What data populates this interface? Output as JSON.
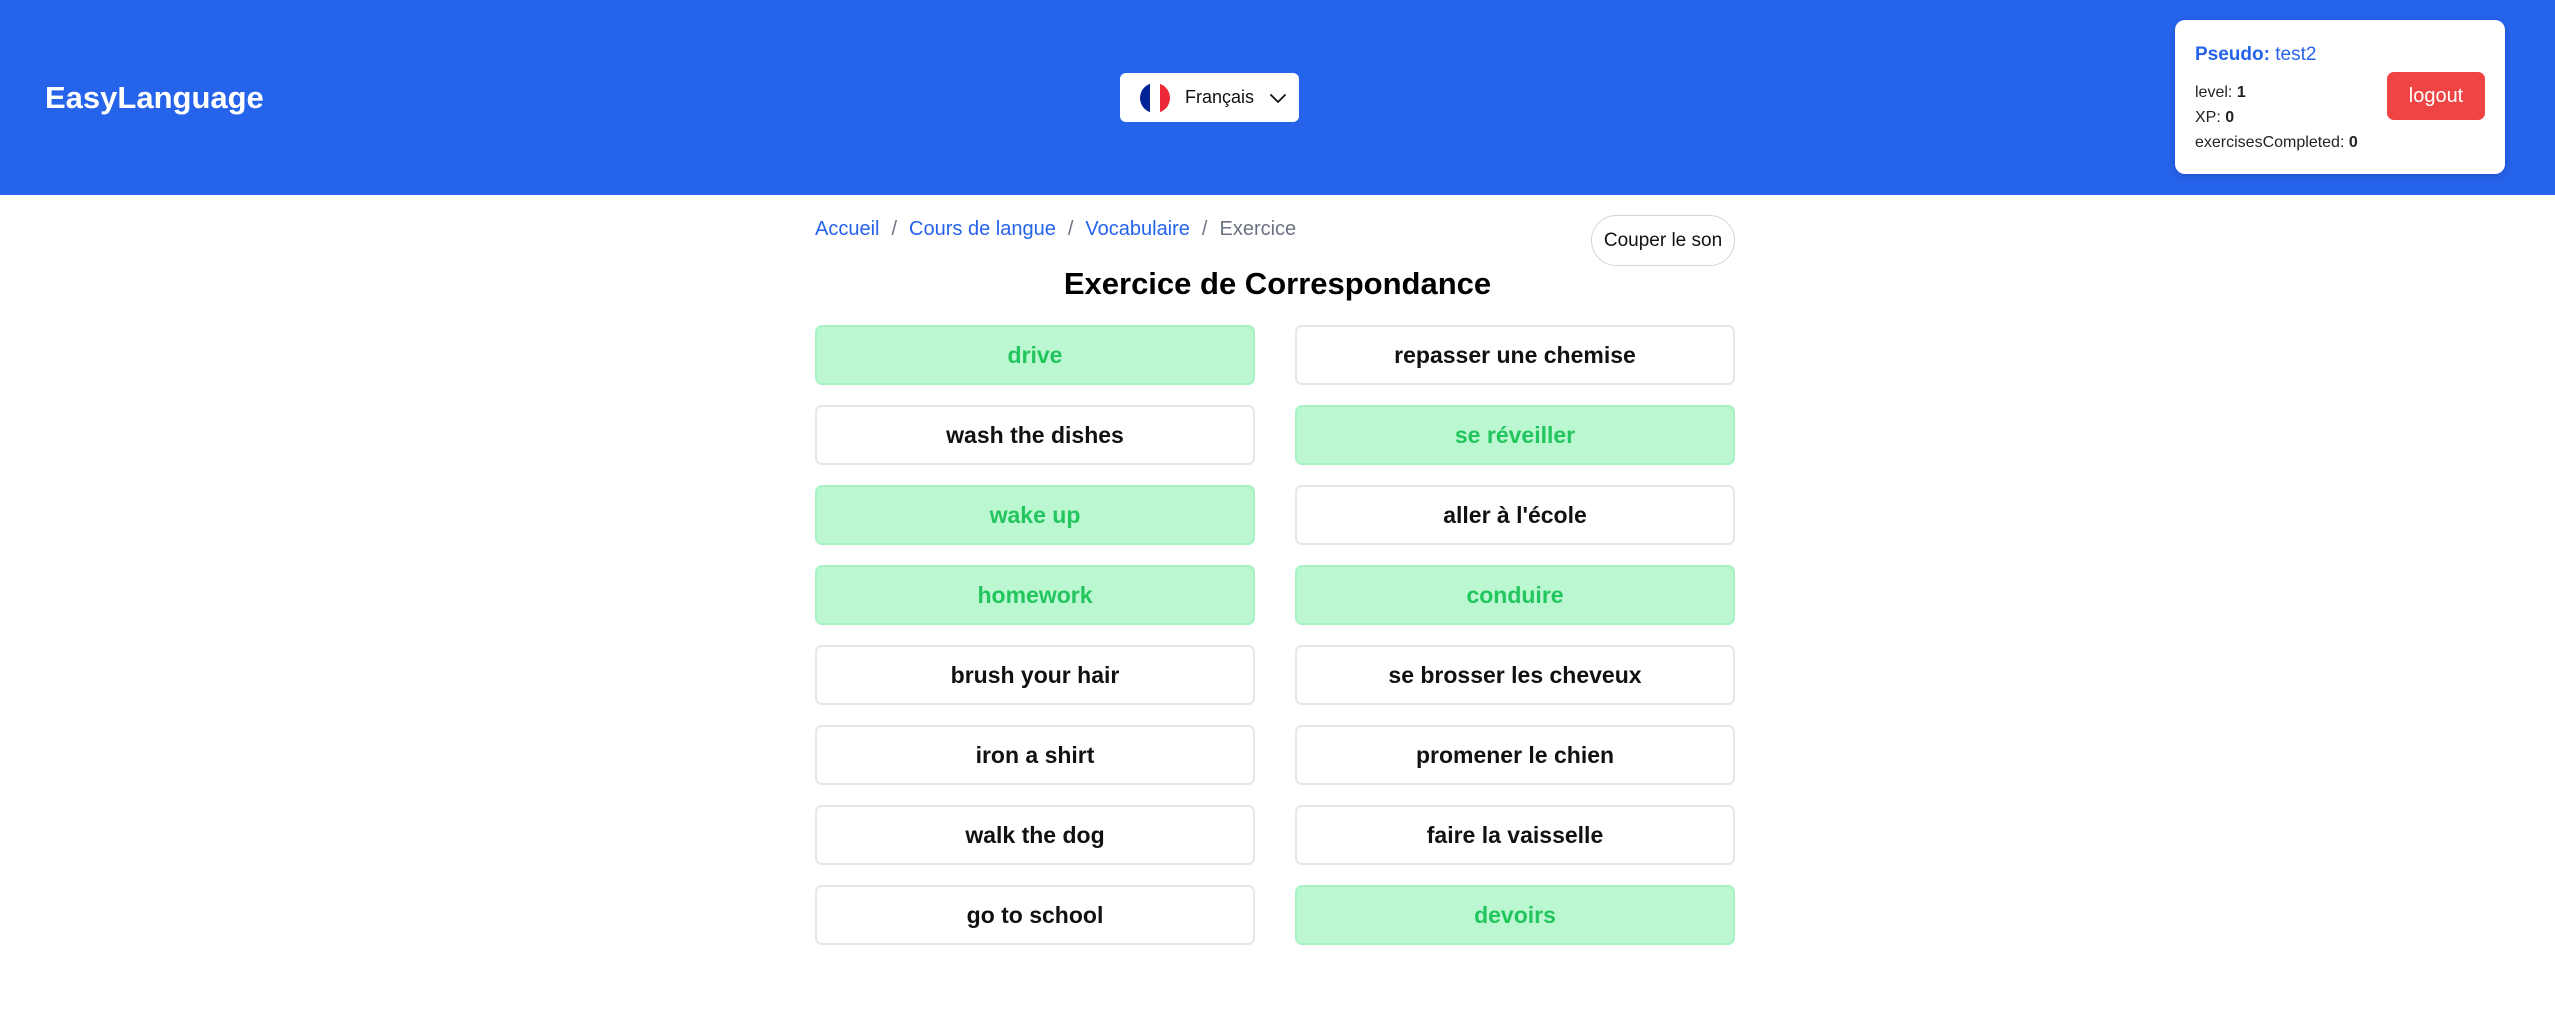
{
  "header": {
    "logo": "EasyLanguage",
    "language": {
      "label": "Français",
      "flag_colors": [
        "#002395",
        "#ffffff",
        "#ed2939"
      ],
      "icon": "chevron-down-icon"
    },
    "user": {
      "pseudo_label": "Pseudo:",
      "pseudo_value": "test2",
      "level_label": "level:",
      "level_value": "1",
      "xp_label": "XP:",
      "xp_value": "0",
      "exercises_label": "exercisesCompleted:",
      "exercises_value": "0",
      "logout_label": "logout"
    }
  },
  "breadcrumb": {
    "items": [
      "Accueil",
      "Cours de langue",
      "Vocabulaire"
    ],
    "current": "Exercice",
    "separator": "/"
  },
  "mute_button": "Couper le son",
  "title": "Exercice de Correspondance",
  "colors": {
    "primary": "#2563eb",
    "danger": "#ef4444",
    "matched_bg": "#bbf7d0",
    "matched_text": "#22c55e"
  },
  "rows": [
    {
      "left": {
        "text": "drive",
        "matched": true
      },
      "right": {
        "text": "repasser une chemise",
        "matched": false
      }
    },
    {
      "left": {
        "text": "wash the dishes",
        "matched": false
      },
      "right": {
        "text": "se réveiller",
        "matched": true
      }
    },
    {
      "left": {
        "text": "wake up",
        "matched": true
      },
      "right": {
        "text": "aller à l'école",
        "matched": false
      }
    },
    {
      "left": {
        "text": "homework",
        "matched": true
      },
      "right": {
        "text": "conduire",
        "matched": true
      }
    },
    {
      "left": {
        "text": "brush your hair",
        "matched": false
      },
      "right": {
        "text": "se brosser les cheveux",
        "matched": false
      }
    },
    {
      "left": {
        "text": "iron a shirt",
        "matched": false
      },
      "right": {
        "text": "promener le chien",
        "matched": false
      }
    },
    {
      "left": {
        "text": "walk the dog",
        "matched": false
      },
      "right": {
        "text": "faire la vaisselle",
        "matched": false
      }
    },
    {
      "left": {
        "text": "go to school",
        "matched": false
      },
      "right": {
        "text": "devoirs",
        "matched": true
      }
    }
  ]
}
